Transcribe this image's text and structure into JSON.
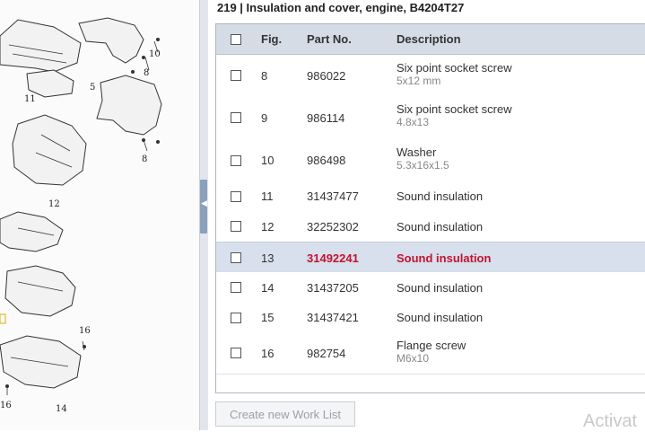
{
  "diagram": {
    "labels": [
      "10",
      "8",
      "5",
      "11",
      "8",
      "12",
      "16",
      "16",
      "14"
    ]
  },
  "panel": {
    "title": "219  |  Insulation and cover, engine, B4204T27",
    "columns": {
      "fig": "Fig.",
      "part_no": "Part No.",
      "description": "Description"
    },
    "rows": [
      {
        "fig": "8",
        "part_no": "986022",
        "description": "Six point socket screw",
        "detail": "5x12 mm"
      },
      {
        "fig": "9",
        "part_no": "986114",
        "description": "Six point socket screw",
        "detail": "4.8x13"
      },
      {
        "fig": "10",
        "part_no": "986498",
        "description": "Washer",
        "detail": "5.3x16x1.5"
      },
      {
        "fig": "11",
        "part_no": "31437477",
        "description": "Sound insulation",
        "detail": ""
      },
      {
        "fig": "12",
        "part_no": "32252302",
        "description": "Sound insulation",
        "detail": ""
      },
      {
        "fig": "13",
        "part_no": "31492241",
        "description": "Sound insulation",
        "detail": "",
        "selected": true
      },
      {
        "fig": "14",
        "part_no": "31437205",
        "description": "Sound insulation",
        "detail": ""
      },
      {
        "fig": "15",
        "part_no": "31437421",
        "description": "Sound insulation",
        "detail": ""
      },
      {
        "fig": "16",
        "part_no": "982754",
        "description": "Flange screw",
        "detail": "M6x10"
      }
    ],
    "create_button": "Create new Work List"
  },
  "watermark": "Activat",
  "colors": {
    "header_bg": "#d5dce6",
    "selected_bg": "#d7e0ec",
    "selected_text": "#c41230"
  },
  "icons": {
    "splitter": "chevron-left-icon"
  }
}
